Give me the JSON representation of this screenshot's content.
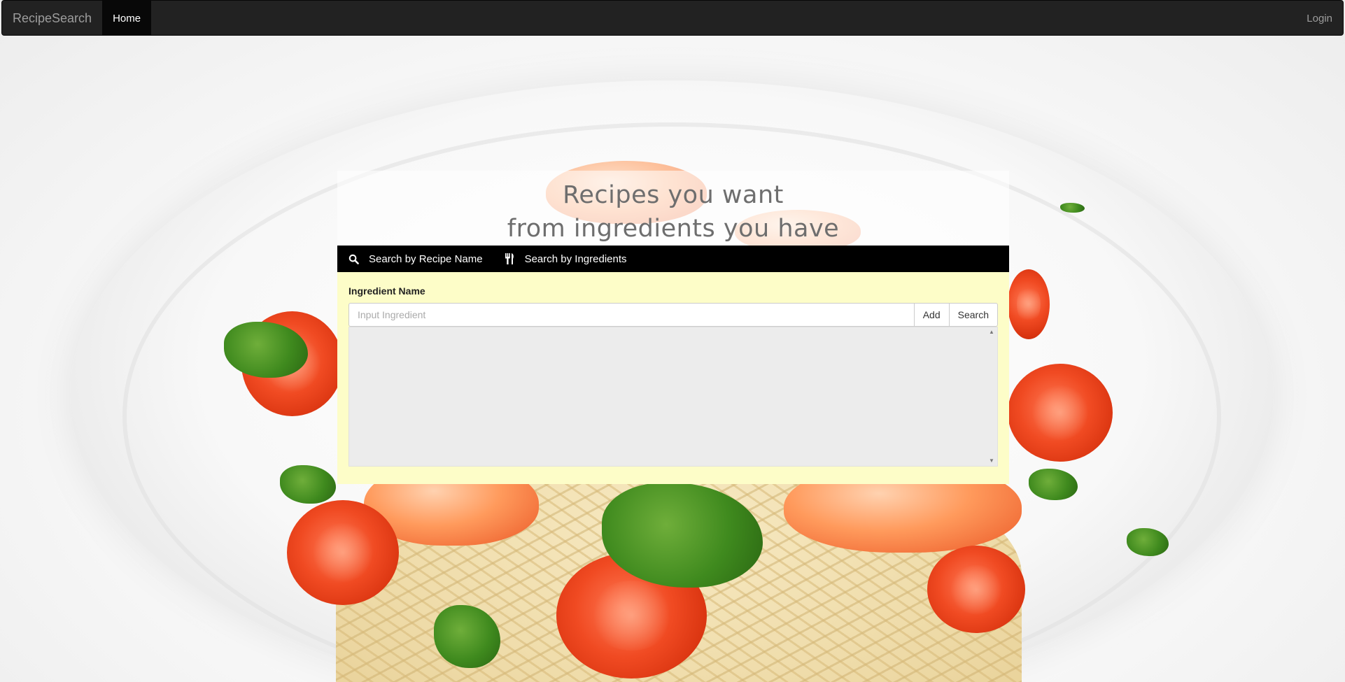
{
  "navbar": {
    "brand": "RecipeSearch",
    "home_label": "Home",
    "login_label": "Login"
  },
  "hero": {
    "line1": "Recipes you want",
    "line2": "from ingredients you have"
  },
  "tabs": [
    {
      "label": "Search by Recipe Name",
      "icon": "search-icon"
    },
    {
      "label": "Search by Ingredients",
      "icon": "cutlery-icon"
    }
  ],
  "form": {
    "field_label": "Ingredient Name",
    "input_value": "",
    "input_placeholder": "Input Ingredient",
    "add_label": "Add",
    "search_label": "Search"
  },
  "colors": {
    "navbar_bg": "#222222",
    "tabs_bg": "#000000",
    "panel_bg": "#fdfdc8",
    "list_bg": "#ececec"
  }
}
